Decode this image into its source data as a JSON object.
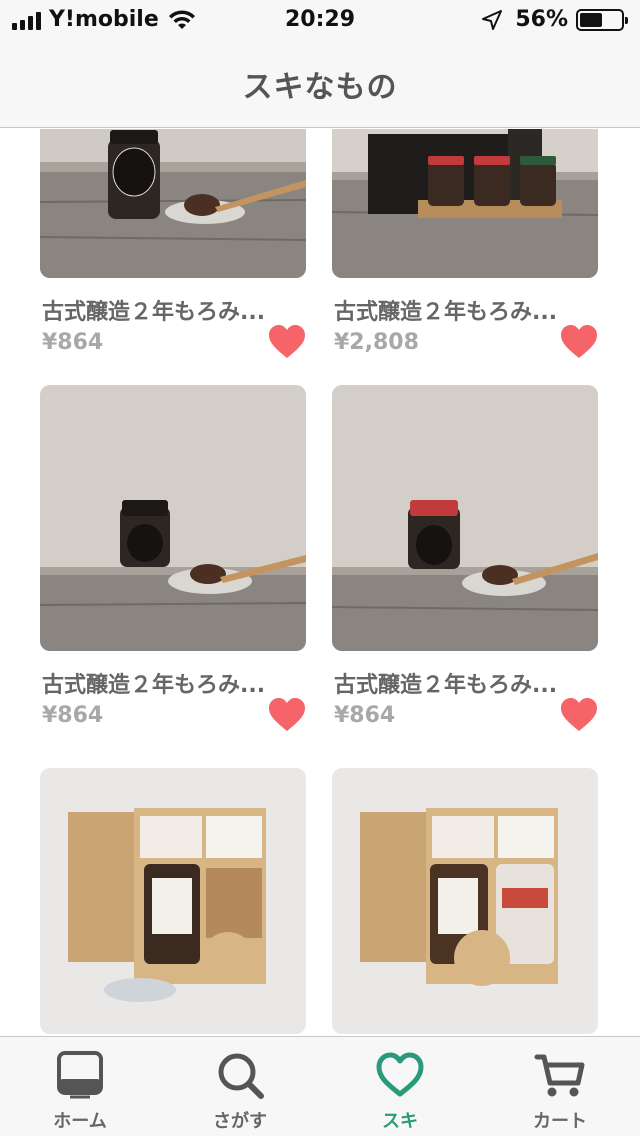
{
  "status_bar": {
    "carrier": "Y!mobile",
    "time": "20:29",
    "battery_percent": "56%",
    "battery_level": 0.56
  },
  "header": {
    "title": "スキなもの"
  },
  "products": [
    {
      "title": "古式醸造２年もろみ...",
      "price": "¥864",
      "favorited": true
    },
    {
      "title": "古式醸造２年もろみ...",
      "price": "¥2,808",
      "favorited": true
    },
    {
      "title": "古式醸造２年もろみ...",
      "price": "¥864",
      "favorited": true
    },
    {
      "title": "古式醸造２年もろみ...",
      "price": "¥864",
      "favorited": true
    },
    {
      "title": "",
      "price": "",
      "favorited": false
    },
    {
      "title": "",
      "price": "",
      "favorited": false
    }
  ],
  "tabs": [
    {
      "label": "ホーム",
      "icon": "home-icon",
      "active": false
    },
    {
      "label": "さがす",
      "icon": "search-icon",
      "active": false
    },
    {
      "label": "スキ",
      "icon": "heart-icon",
      "active": true
    },
    {
      "label": "カート",
      "icon": "cart-icon",
      "active": false
    }
  ],
  "colors": {
    "accent": "#2a9a7c",
    "heart": "#f56468",
    "price": "#a8a8a8"
  }
}
